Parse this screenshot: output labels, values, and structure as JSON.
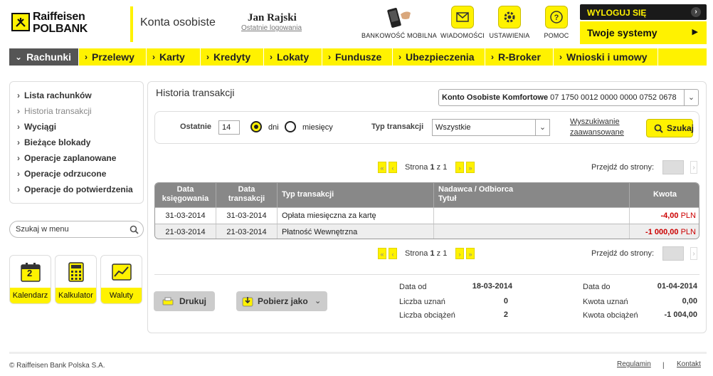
{
  "header": {
    "logo_line1": "Raiffeisen",
    "logo_line2": "POLBANK",
    "app_title": "Konta osobiste",
    "user_name": "Jan Rajski",
    "last_logins": "Ostatnie logowania",
    "tools": [
      {
        "label": "BANKOWOŚĆ MOBILNA",
        "icon": "phone-icon"
      },
      {
        "label": "WIADOMOŚCI",
        "icon": "envelope-icon"
      },
      {
        "label": "USTAWIENIA",
        "icon": "gear-icon"
      },
      {
        "label": "POMOC",
        "icon": "help-icon"
      }
    ],
    "logout": "WYLOGUJ SIĘ",
    "systems": "Twoje systemy"
  },
  "nav": {
    "items": [
      "Rachunki",
      "Przelewy",
      "Karty",
      "Kredyty",
      "Lokaty",
      "Fundusze",
      "Ubezpieczenia",
      "R-Broker",
      "Wnioski i umowy"
    ]
  },
  "sidebar": {
    "items": [
      "Lista rachunków",
      "Historia transakcji",
      "Wyciągi",
      "Bieżące blokady",
      "Operacje zaplanowane",
      "Operacje odrzucone",
      "Operacje do potwierdzenia"
    ],
    "search_placeholder": "Szukaj w menu",
    "tiles": [
      {
        "label": "Kalendarz",
        "icon": "calendar-icon",
        "number": "2"
      },
      {
        "label": "Kalkulator",
        "icon": "calculator-icon"
      },
      {
        "label": "Waluty",
        "icon": "chart-icon"
      }
    ]
  },
  "main": {
    "title": "Historia transakcji",
    "account_name": "Konto Osobiste Komfortowe",
    "account_number": "07 1750 0012 0000 0000 0752 0678",
    "filter": {
      "last_label": "Ostatnie",
      "last_value": "14",
      "unit_days": "dni",
      "unit_months": "miesięcy",
      "type_label": "Typ transakcji",
      "type_value": "Wszystkie",
      "advanced_line1": "Wyszukiwanie",
      "advanced_line2": "zaawansowane",
      "search_button": "Szukaj"
    },
    "pagination": {
      "page_prefix": "Strona",
      "page": "1",
      "of": "z",
      "total": "1",
      "goto_label": "Przejdź do strony:"
    },
    "table": {
      "headers": [
        "Data księgowania",
        "Data transakcji",
        "Typ transakcji",
        "Nadawca / Odbiorca Tytuł",
        "Kwota"
      ],
      "header_parts": {
        "booking_1": "Data",
        "booking_2": "księgowania",
        "trans_1": "Data",
        "trans_2": "transakcji",
        "party_1": "Nadawca / Odbiorca",
        "party_2": "Tytuł"
      },
      "rows": [
        {
          "booking_date": "31-03-2014",
          "transaction_date": "31-03-2014",
          "type": "Opłata miesięczna za kartę",
          "party": "",
          "amount": "-4,00",
          "currency": "PLN"
        },
        {
          "booking_date": "21-03-2014",
          "transaction_date": "21-03-2014",
          "type": "Płatność Wewnętrzna",
          "party": "",
          "amount": "-1 000,00",
          "currency": "PLN"
        }
      ]
    },
    "actions": {
      "print": "Drukuj",
      "download": "Pobierz jako"
    },
    "summary": {
      "date_from_label": "Data od",
      "date_from": "18-03-2014",
      "credits_count_label": "Liczba uznań",
      "credits_count": "0",
      "debits_count_label": "Liczba obciążeń",
      "debits_count": "2",
      "date_to_label": "Data do",
      "date_to": "01-04-2014",
      "credits_amount_label": "Kwota uznań",
      "credits_amount": "0,00",
      "debits_amount_label": "Kwota obciążeń",
      "debits_amount": "-1 004,00"
    }
  },
  "footer": {
    "copyright": "© Raiffeisen Bank Polska S.A.",
    "links": [
      "Regulamin",
      "Kontakt"
    ],
    "divider": "|"
  },
  "colors": {
    "accent": "#fff200",
    "nav_active": "#555555",
    "negative": "#cc0000",
    "table_header": "#888888"
  }
}
